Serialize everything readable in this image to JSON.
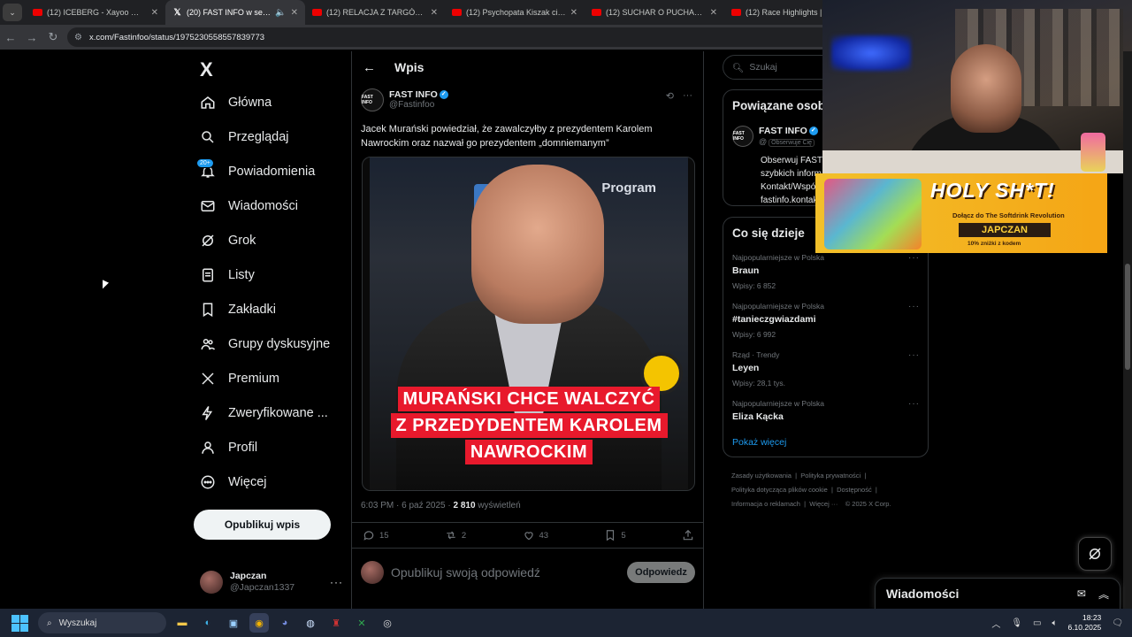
{
  "browser": {
    "tabs": [
      {
        "title": "(12) ICEBERG - Xayoo 🙈 - You",
        "kind": "yt"
      },
      {
        "title": "(20) FAST INFO w serwisie X",
        "kind": "x"
      },
      {
        "title": "(12) RELACJA Z TARGÓW FIWE",
        "kind": "yt"
      },
      {
        "title": "(12) Psychopata Kiszak ciśnie w",
        "kind": "yt"
      },
      {
        "title": "(12) SUCHAR O PUCHACZU! KO",
        "kind": "yt"
      },
      {
        "title": "(12) Race Highlights | 2025",
        "kind": "yt"
      }
    ],
    "url": "x.com/Fastinfoo/status/1975230558557839773"
  },
  "sidebar": {
    "logo": "X",
    "items": [
      {
        "label": "Główna",
        "icon": "home-icon"
      },
      {
        "label": "Przeglądaj",
        "icon": "search-icon"
      },
      {
        "label": "Powiadomienia",
        "icon": "bell-icon",
        "badge": "20+"
      },
      {
        "label": "Wiadomości",
        "icon": "mail-icon"
      },
      {
        "label": "Grok",
        "icon": "grok-icon"
      },
      {
        "label": "Listy",
        "icon": "list-icon"
      },
      {
        "label": "Zakładki",
        "icon": "bookmark-icon"
      },
      {
        "label": "Grupy dyskusyjne",
        "icon": "people-icon"
      },
      {
        "label": "Premium",
        "icon": "x-icon"
      },
      {
        "label": "Zweryfikowane ...",
        "icon": "lightning-icon"
      },
      {
        "label": "Profil",
        "icon": "person-icon"
      },
      {
        "label": "Więcej",
        "icon": "more-circle-icon"
      }
    ],
    "post_button": "Opublikuj wpis",
    "account": {
      "name": "Japczan",
      "handle": "@Japczan1337",
      "more": "···"
    }
  },
  "post": {
    "header_title": "Wpis",
    "author_name": "FAST INFO",
    "author_handle": "@Fastinfoo",
    "avatar_text": "FAST INFO",
    "text": "Jacek Murański powiedział, że zawalczyłby z prezydentem Karolem Nawrockim oraz nazwał go prezydentem „domniemanym”",
    "media_caption": [
      "MURAŃSKI CHCE WALCZYĆ",
      "Z PRZEDYDENTEM KAROLEM",
      "NAWROCKIM"
    ],
    "media_bg_text": "Program",
    "timestamp": "6:03 PM · 6 paź 2025 · ",
    "views": "2 810",
    "views_label": " wyświetleń",
    "stats": {
      "replies": "15",
      "reposts": "2",
      "likes": "43",
      "bookmarks": "5"
    },
    "reply_placeholder": "Opublikuj swoją odpowiedź",
    "reply_button": "Odpowiedz"
  },
  "right": {
    "search_placeholder": "Szukaj",
    "related_title": "Powiązane osob",
    "related_user": {
      "name": "FAST INFO",
      "follows": "Obserwuje Cię",
      "bio": [
        "Obserwuj FAST",
        "szybkich inform",
        "Kontakt/Współpraca",
        "fastinfo.kontakt@gm"
      ]
    },
    "trends_title": "Co się dzieje",
    "trends": [
      {
        "category": "Najpopularniejsze w Polska",
        "title": "Braun",
        "count": "Wpisy: 6 852"
      },
      {
        "category": "Najpopularniejsze w Polska",
        "title": "#tanieczgwiazdami",
        "count": "Wpisy: 6 992"
      },
      {
        "category": "Rząd · Trendy",
        "title": "Leyen",
        "count": "Wpisy: 28,1 tys."
      },
      {
        "category": "Najpopularniejsze w Polska",
        "title": "Eliza Kącka",
        "count": ""
      }
    ],
    "show_more": "Pokaż więcej",
    "footer": [
      "Zasady użytkowania",
      "Polityka prywatności",
      "Polityka dotycząca plików cookie",
      "Dostępność",
      "Informacja o reklamach",
      "Więcej ···",
      "© 2025 X Corp."
    ]
  },
  "overlay": {
    "banner_title": "HOLY SH*T!",
    "banner_sub": "Dołącz do The Softdrink Revolution",
    "banner_brand": "JAPCZAN",
    "banner_discount": "10% zniżki z kodem"
  },
  "messages_drawer": {
    "title": "Wiadomości"
  },
  "taskbar": {
    "search": "Wyszukaj",
    "time": "18:23",
    "date": "6.10.2025"
  },
  "colors": {
    "accent": "#1d9bf0",
    "bg": "#000000",
    "border": "#2f3336",
    "caption_red": "#e8192c"
  }
}
